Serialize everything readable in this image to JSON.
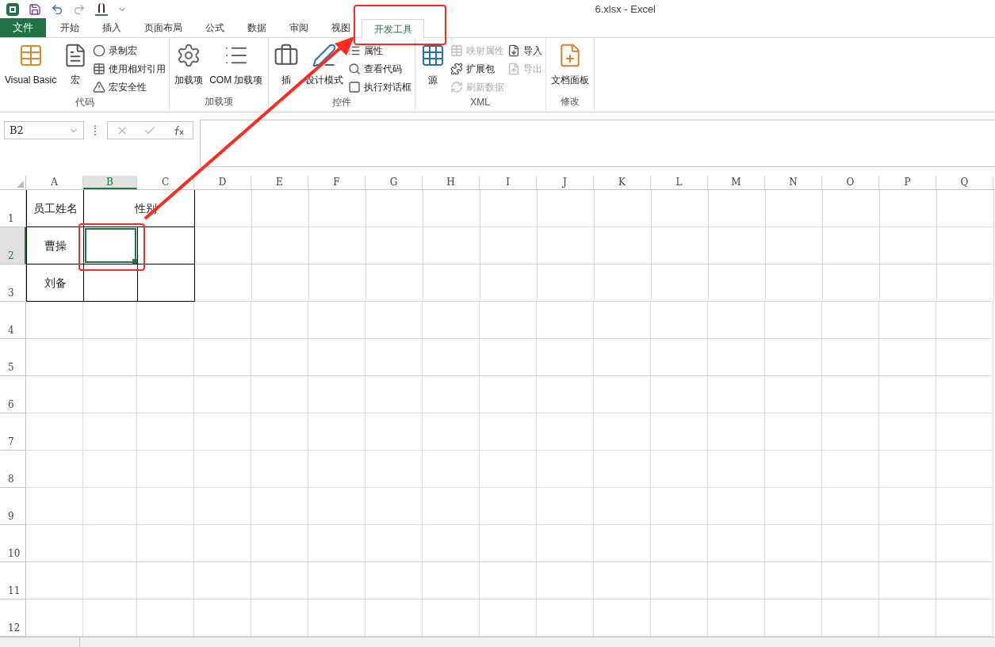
{
  "window": {
    "title": "6.xlsx - Excel"
  },
  "tabs": [
    {
      "label": "文件",
      "kind": "file",
      "selected": false
    },
    {
      "label": "开始",
      "kind": "tab",
      "selected": false
    },
    {
      "label": "插入",
      "kind": "tab",
      "selected": false
    },
    {
      "label": "页面布局",
      "kind": "tab",
      "selected": false
    },
    {
      "label": "公式",
      "kind": "tab",
      "selected": false
    },
    {
      "label": "数据",
      "kind": "tab",
      "selected": false
    },
    {
      "label": "审阅",
      "kind": "tab",
      "selected": false
    },
    {
      "label": "视图",
      "kind": "tab",
      "selected": false
    },
    {
      "label": "开发工具",
      "kind": "tab",
      "selected": true
    }
  ],
  "ribbon_groups": [
    {
      "label": "代码",
      "items": [
        {
          "kind": "large",
          "label": "Visual Basic",
          "disabled": false
        },
        {
          "kind": "large",
          "label": "宏",
          "disabled": false
        },
        {
          "kind": "stack",
          "items": [
            {
              "label": "录制宏",
              "disabled": false
            },
            {
              "label": "使用相对引用",
              "disabled": false
            },
            {
              "label": "宏安全性",
              "disabled": false
            }
          ]
        }
      ]
    },
    {
      "label": "加载项",
      "items": [
        {
          "kind": "large",
          "label": "加载项",
          "disabled": false
        },
        {
          "kind": "large",
          "label": "COM 加载项",
          "disabled": false
        }
      ]
    },
    {
      "label": "控件",
      "items": [
        {
          "kind": "large",
          "label": "插",
          "disabled": false
        },
        {
          "kind": "large",
          "label": "设计模式",
          "disabled": false
        },
        {
          "kind": "stack",
          "items": [
            {
              "label": "属性",
              "disabled": false
            },
            {
              "label": "查看代码",
              "disabled": false
            },
            {
              "label": "执行对话框",
              "disabled": false
            }
          ]
        }
      ]
    },
    {
      "label": "XML",
      "items": [
        {
          "kind": "large",
          "label": "源",
          "disabled": false
        },
        {
          "kind": "stack",
          "items": [
            {
              "label": "映射属性",
              "disabled": true
            },
            {
              "label": "扩展包",
              "disabled": false
            },
            {
              "label": "刷新数据",
              "disabled": true
            }
          ]
        },
        {
          "kind": "stack",
          "items": [
            {
              "label": "导入",
              "disabled": false
            },
            {
              "label": "导出",
              "disabled": true
            }
          ]
        }
      ]
    },
    {
      "label": "修改",
      "items": [
        {
          "kind": "large",
          "label": "文档面板",
          "disabled": false
        }
      ]
    }
  ],
  "formula_bar": {
    "name_box": "B2"
  },
  "columns": [
    {
      "label": "A",
      "selected": false
    },
    {
      "label": "B",
      "selected": true
    },
    {
      "label": "C",
      "selected": false
    },
    {
      "label": "D",
      "selected": false
    },
    {
      "label": "E",
      "selected": false
    },
    {
      "label": "F",
      "selected": false
    },
    {
      "label": "G",
      "selected": false
    },
    {
      "label": "H",
      "selected": false
    },
    {
      "label": "I",
      "selected": false
    },
    {
      "label": "J",
      "selected": false
    },
    {
      "label": "K",
      "selected": false
    },
    {
      "label": "L",
      "selected": false
    },
    {
      "label": "M",
      "selected": false
    },
    {
      "label": "N",
      "selected": false
    },
    {
      "label": "O",
      "selected": false
    },
    {
      "label": "P",
      "selected": false
    },
    {
      "label": "Q",
      "selected": false
    }
  ],
  "rows": [
    {
      "label": "1",
      "selected": false,
      "cells": [
        {
          "kind": "text",
          "text": "员工姓名"
        },
        {
          "kind": "merged",
          "text": "性别"
        }
      ]
    },
    {
      "label": "2",
      "selected": true,
      "cells": [
        {
          "kind": "text",
          "text": "曹操"
        },
        {
          "kind": "active"
        },
        {
          "kind": "blank"
        }
      ]
    },
    {
      "label": "3",
      "selected": false,
      "cells": [
        {
          "kind": "text",
          "text": "刘备"
        },
        {
          "kind": "blank"
        },
        {
          "kind": "blank"
        }
      ]
    },
    {
      "label": "4",
      "selected": false
    },
    {
      "label": "5",
      "selected": false
    },
    {
      "label": "6",
      "selected": false
    },
    {
      "label": "7",
      "selected": false
    },
    {
      "label": "8",
      "selected": false
    },
    {
      "label": "9",
      "selected": false
    },
    {
      "label": "10",
      "selected": false
    },
    {
      "label": "11",
      "selected": false
    },
    {
      "label": "12",
      "selected": false
    }
  ]
}
